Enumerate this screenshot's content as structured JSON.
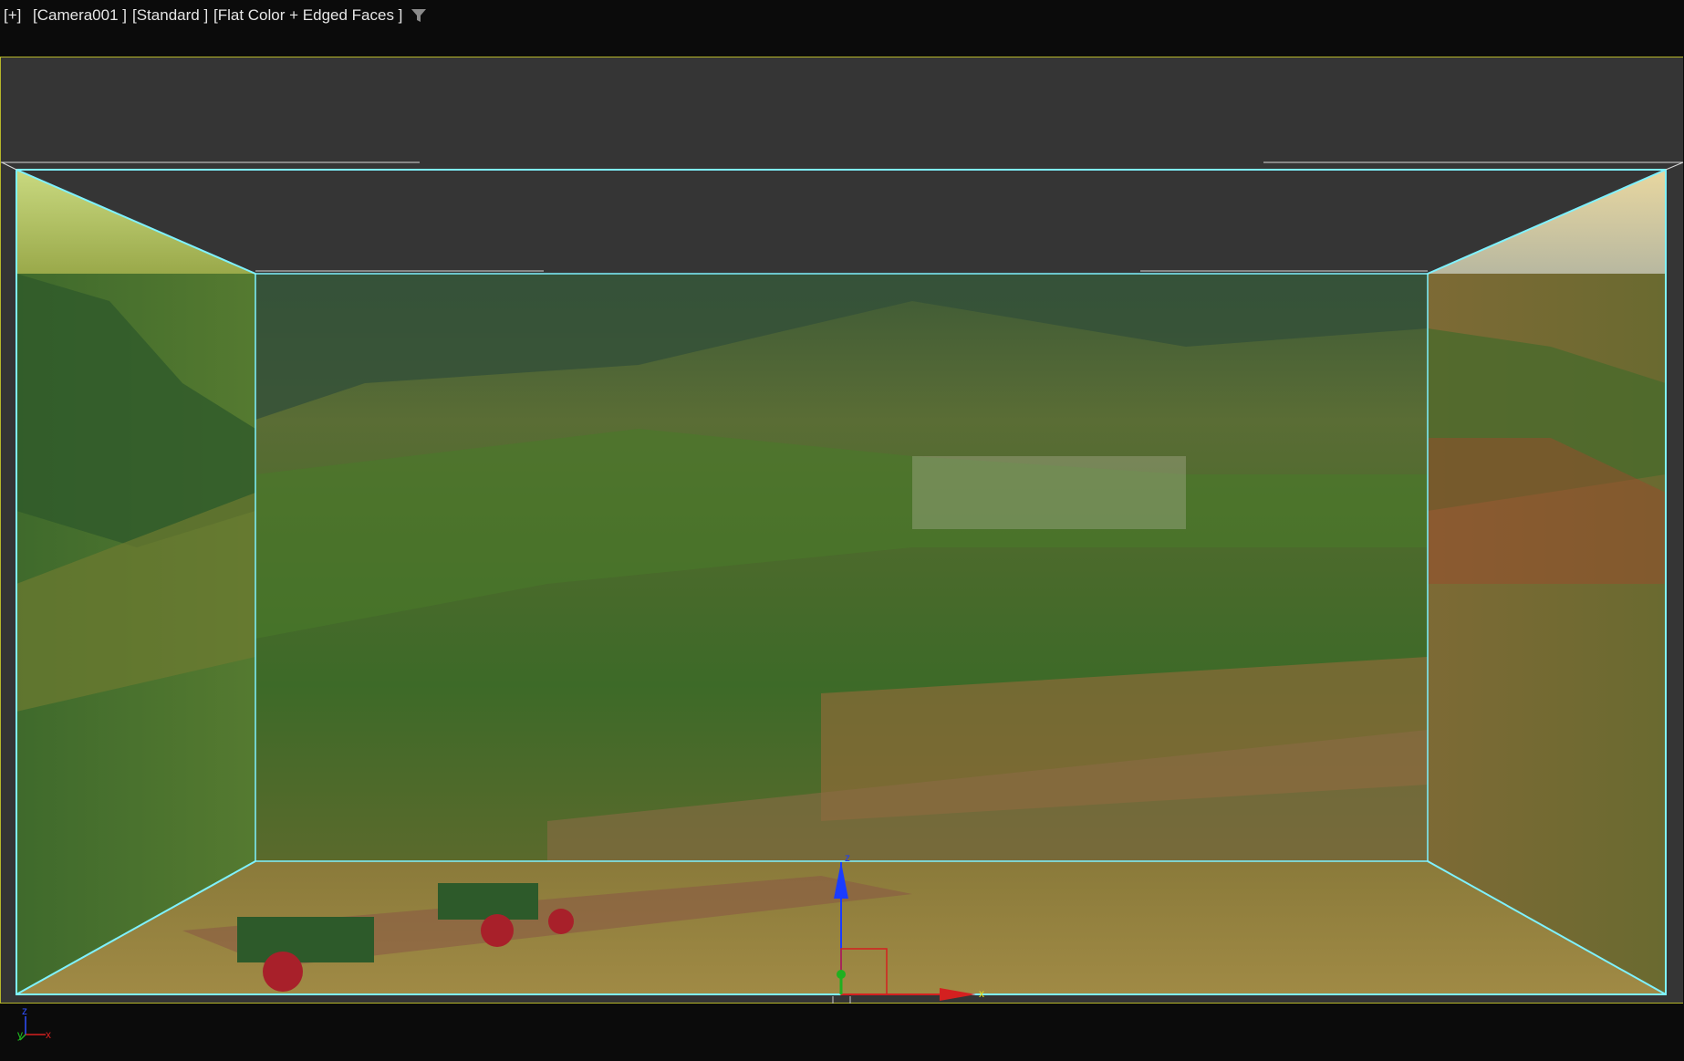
{
  "viewport": {
    "menu_label": "[+]",
    "camera_label": "[Camera001 ]",
    "lighting_label": "[Standard ]",
    "shading_label": "[Flat Color + Edged Faces ]"
  },
  "gizmo": {
    "z_label": "z",
    "x_label": "x"
  },
  "tripod": {
    "z_label": "z",
    "y_label": "y",
    "x_label": "x"
  },
  "colors": {
    "viewport_bg": "#353535",
    "frame_border": "#b5b52a",
    "selection_edge": "#7ff2ff",
    "axis_z": "#1a3cff",
    "axis_x": "#d42020",
    "axis_y": "#20b020"
  },
  "icons": {
    "filter": "funnel-icon"
  }
}
